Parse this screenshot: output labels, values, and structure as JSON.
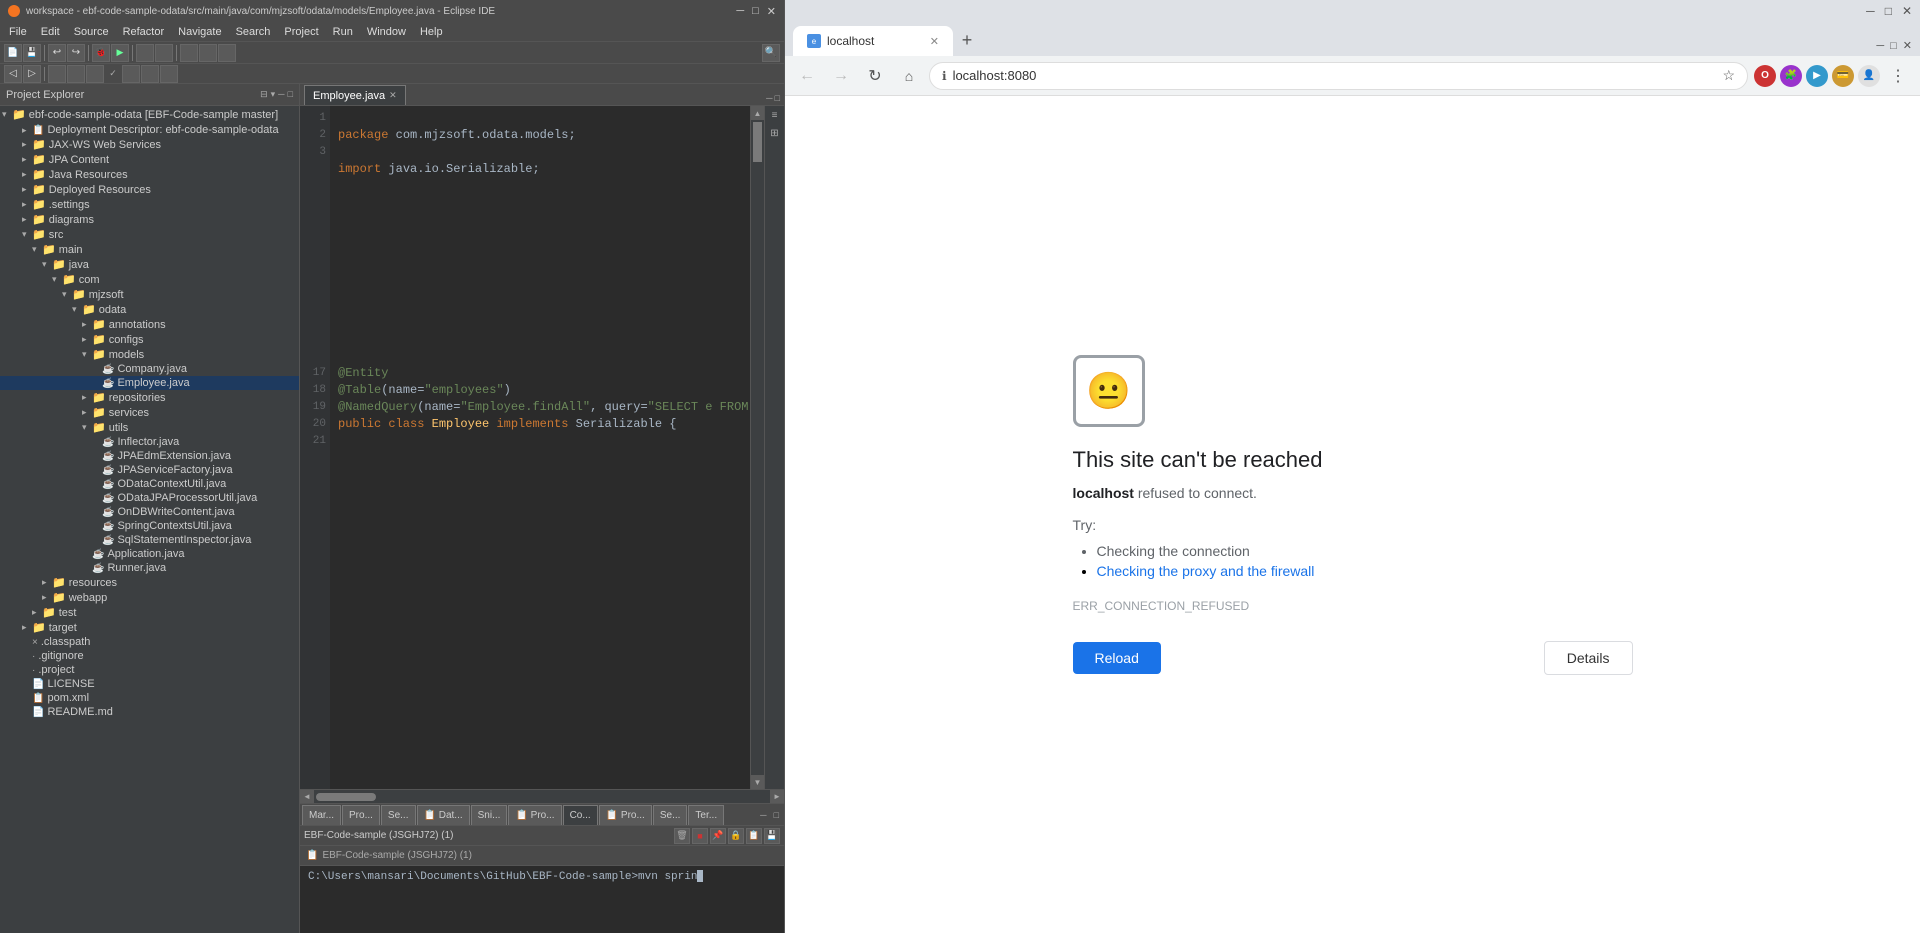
{
  "eclipse": {
    "title": "workspace - ebf-code-sample-odata/src/main/java/com/mjzsoft/odata/models/Employee.java - Eclipse IDE",
    "menu_items": [
      "File",
      "Edit",
      "Source",
      "Refactor",
      "Navigate",
      "Search",
      "Project",
      "Run",
      "Window",
      "Help"
    ],
    "active_file_tab": "Employee.java",
    "project_explorer_title": "Project Explorer",
    "project": {
      "name": "ebf-code-sample-odata [EBF-Code-sample master]",
      "children": [
        {
          "label": "Deployment Descriptor: ebf-code-sample-odata",
          "indent": 1,
          "type": "descriptor"
        },
        {
          "label": "JAX-WS Web Services",
          "indent": 1,
          "type": "folder"
        },
        {
          "label": "JPA Content",
          "indent": 1,
          "type": "folder"
        },
        {
          "label": "Java Resources",
          "indent": 1,
          "type": "folder"
        },
        {
          "label": "Deployed Resources",
          "indent": 1,
          "type": "folder"
        },
        {
          "label": ".settings",
          "indent": 1,
          "type": "folder"
        },
        {
          "label": "diagrams",
          "indent": 1,
          "type": "folder"
        },
        {
          "label": "src",
          "indent": 1,
          "type": "folder",
          "expanded": true
        },
        {
          "label": "main",
          "indent": 2,
          "type": "folder",
          "expanded": true
        },
        {
          "label": "java",
          "indent": 3,
          "type": "folder",
          "expanded": true
        },
        {
          "label": "com",
          "indent": 4,
          "type": "folder",
          "expanded": true
        },
        {
          "label": "mjzsoft",
          "indent": 5,
          "type": "folder",
          "expanded": true
        },
        {
          "label": "odata",
          "indent": 6,
          "type": "folder",
          "expanded": true
        },
        {
          "label": "annotations",
          "indent": 7,
          "type": "folder"
        },
        {
          "label": "configs",
          "indent": 7,
          "type": "folder"
        },
        {
          "label": "models",
          "indent": 7,
          "type": "folder",
          "expanded": true
        },
        {
          "label": "Company.java",
          "indent": 8,
          "type": "java"
        },
        {
          "label": "Employee.java",
          "indent": 8,
          "type": "java",
          "selected": true
        },
        {
          "label": "repositories",
          "indent": 7,
          "type": "folder"
        },
        {
          "label": "services",
          "indent": 7,
          "type": "folder"
        },
        {
          "label": "utils",
          "indent": 7,
          "type": "folder",
          "expanded": true
        },
        {
          "label": "Inflector.java",
          "indent": 8,
          "type": "java"
        },
        {
          "label": "JPAEdmExtension.java",
          "indent": 8,
          "type": "java"
        },
        {
          "label": "JPAServiceFactory.java",
          "indent": 8,
          "type": "java"
        },
        {
          "label": "ODataContextUtil.java",
          "indent": 8,
          "type": "java"
        },
        {
          "label": "ODataJPAProcessorUtil.java",
          "indent": 8,
          "type": "java"
        },
        {
          "label": "OnDBWriteContent.java",
          "indent": 8,
          "type": "java"
        },
        {
          "label": "SpringContextsUtil.java",
          "indent": 8,
          "type": "java"
        },
        {
          "label": "SqlStatementInspector.java",
          "indent": 8,
          "type": "java"
        },
        {
          "label": "Application.java",
          "indent": 7,
          "type": "java"
        },
        {
          "label": "Runner.java",
          "indent": 7,
          "type": "java"
        },
        {
          "label": "resources",
          "indent": 3,
          "type": "folder"
        },
        {
          "label": "webapp",
          "indent": 3,
          "type": "folder"
        },
        {
          "label": "test",
          "indent": 2,
          "type": "folder"
        },
        {
          "label": "target",
          "indent": 1,
          "type": "folder"
        },
        {
          "label": ".classpath",
          "indent": 1,
          "type": "file"
        },
        {
          "label": ".gitignore",
          "indent": 1,
          "type": "file"
        },
        {
          "label": ".project",
          "indent": 1,
          "type": "file"
        },
        {
          "label": "LICENSE",
          "indent": 1,
          "type": "file"
        },
        {
          "label": "pom.xml",
          "indent": 1,
          "type": "xml"
        },
        {
          "label": "README.md",
          "indent": 1,
          "type": "file"
        }
      ]
    },
    "code": {
      "filename": "Employee.java",
      "lines": [
        {
          "num": 1,
          "text": "package com.mjzsoft.odata.models;"
        },
        {
          "num": 2,
          "text": ""
        },
        {
          "num": 3,
          "text": "import java.io.Serializable;"
        },
        {
          "num": 17,
          "text": ""
        },
        {
          "num": 18,
          "text": "@Entity"
        },
        {
          "num": 19,
          "text": "@Table(name=\"employees\")"
        },
        {
          "num": 20,
          "text": "@NamedQuery(name=\"Employee.findAll\", query=\"SELECT e FROM Employee e"
        },
        {
          "num": 21,
          "text": "public class Employee implements Serializable {"
        }
      ]
    },
    "console": {
      "title": "EBF-Code-sample (JSGHJ72) (1)",
      "command": "C:\\Users\\mansari\\Documents\\GitHub\\EBF-Code-sample>mvn sprin"
    }
  },
  "browser": {
    "tab_title": "localhost",
    "url": "localhost:8080",
    "error": {
      "title": "This site can't be reached",
      "host": "localhost",
      "desc": " refused to connect.",
      "try_label": "Try:",
      "suggestions": [
        {
          "text": "Checking the connection",
          "link": false
        },
        {
          "text": "Checking the proxy and the firewall",
          "link": true
        }
      ],
      "error_code": "ERR_CONNECTION_REFUSED",
      "reload_label": "Reload",
      "details_label": "Details"
    }
  }
}
